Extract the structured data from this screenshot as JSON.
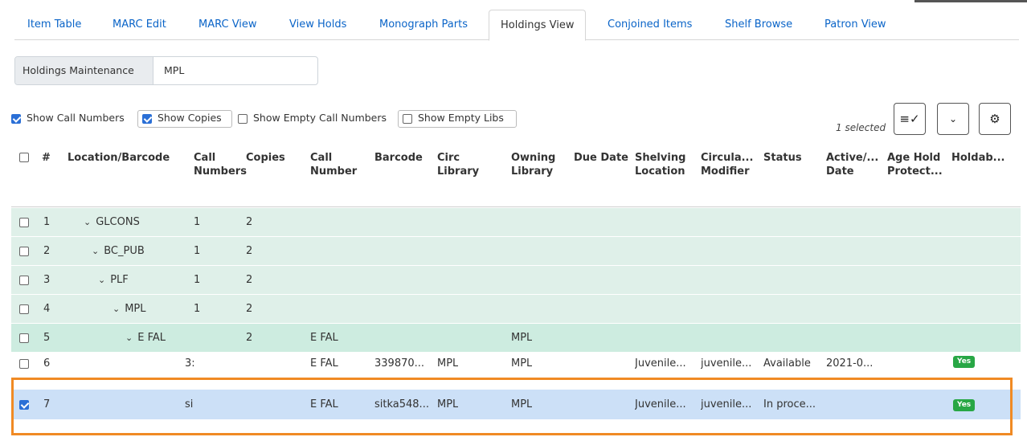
{
  "tabs": [
    {
      "label": "Item Table",
      "active": false
    },
    {
      "label": "MARC Edit",
      "active": false
    },
    {
      "label": "MARC View",
      "active": false
    },
    {
      "label": "View Holds",
      "active": false
    },
    {
      "label": "Monograph Parts",
      "active": false
    },
    {
      "label": "Holdings View",
      "active": true
    },
    {
      "label": "Conjoined Items",
      "active": false
    },
    {
      "label": "Shelf Browse",
      "active": false
    },
    {
      "label": "Patron View",
      "active": false
    }
  ],
  "maintenance": {
    "label": "Holdings Maintenance",
    "value": "MPL"
  },
  "options": {
    "show_call_numbers": {
      "label": "Show Call Numbers",
      "checked": true
    },
    "show_copies": {
      "label": "Show Copies",
      "checked": true
    },
    "show_empty_call_numbers": {
      "label": "Show Empty Call Numbers",
      "checked": false
    },
    "show_empty_libs": {
      "label": "Show Empty Libs",
      "checked": false
    }
  },
  "selection": {
    "count_text": "1 selected"
  },
  "toolbar": {
    "actions_icon": "list-check-icon",
    "menu_icon": "chevron-down-icon",
    "settings_icon": "gear-icon"
  },
  "columns": [
    "#",
    "Location/Barcode",
    "Call Numbers",
    "Copies",
    "Call Number",
    "Barcode",
    "Circ Library",
    "Owning Library",
    "Due Date",
    "Shelving Location",
    "Circula... Modifier",
    "Status",
    "Active/... Date",
    "Age Hold Protect...",
    "Holdab..."
  ],
  "rows": [
    {
      "num": "1",
      "location": "GLCONS",
      "chevron": true,
      "call_numbers": "1",
      "copies": "2",
      "call_number": "",
      "barcode": "",
      "circ_library": "",
      "owning_library": "",
      "shelving": "",
      "circ_modifier": "",
      "status": "",
      "active_date": "",
      "holdable": "",
      "checked": false
    },
    {
      "num": "2",
      "location": "BC_PUB",
      "chevron": true,
      "call_numbers": "1",
      "copies": "2",
      "call_number": "",
      "barcode": "",
      "circ_library": "",
      "owning_library": "",
      "shelving": "",
      "circ_modifier": "",
      "status": "",
      "active_date": "",
      "holdable": "",
      "checked": false
    },
    {
      "num": "3",
      "location": "PLF",
      "chevron": true,
      "call_numbers": "1",
      "copies": "2",
      "call_number": "",
      "barcode": "",
      "circ_library": "",
      "owning_library": "",
      "shelving": "",
      "circ_modifier": "",
      "status": "",
      "active_date": "",
      "holdable": "",
      "checked": false
    },
    {
      "num": "4",
      "location": "MPL",
      "chevron": true,
      "call_numbers": "1",
      "copies": "2",
      "call_number": "",
      "barcode": "",
      "circ_library": "",
      "owning_library": "",
      "shelving": "",
      "circ_modifier": "",
      "status": "",
      "active_date": "",
      "holdable": "",
      "checked": false
    },
    {
      "num": "5",
      "location": "E FAL",
      "chevron": true,
      "call_numbers": "",
      "copies": "2",
      "call_number": "E FAL",
      "barcode": "",
      "circ_library": "",
      "owning_library": "MPL",
      "shelving": "",
      "circ_modifier": "",
      "status": "",
      "active_date": "",
      "holdable": "",
      "checked": false
    },
    {
      "num": "6",
      "location": "3:",
      "chevron": false,
      "call_numbers": "",
      "copies": "",
      "call_number": "E FAL",
      "barcode": "339870...",
      "circ_library": "MPL",
      "owning_library": "MPL",
      "shelving": "Juvenile...",
      "circ_modifier": "juvenile...",
      "status": "Available",
      "active_date": "2021-0...",
      "holdable": "Yes",
      "checked": false
    },
    {
      "num": "7",
      "location": "si",
      "chevron": false,
      "call_numbers": "",
      "copies": "",
      "call_number": "E FAL",
      "barcode": "sitka548...",
      "circ_library": "MPL",
      "owning_library": "MPL",
      "shelving": "Juvenile...",
      "circ_modifier": "juvenile...",
      "status": "In proce...",
      "active_date": "",
      "holdable": "Yes",
      "checked": true
    }
  ],
  "colors": {
    "accent": "#0a64c8",
    "group_row": "#dff0e9",
    "selected_row": "#cce0f7",
    "highlight": "#f08a24",
    "badge": "#28a745"
  }
}
